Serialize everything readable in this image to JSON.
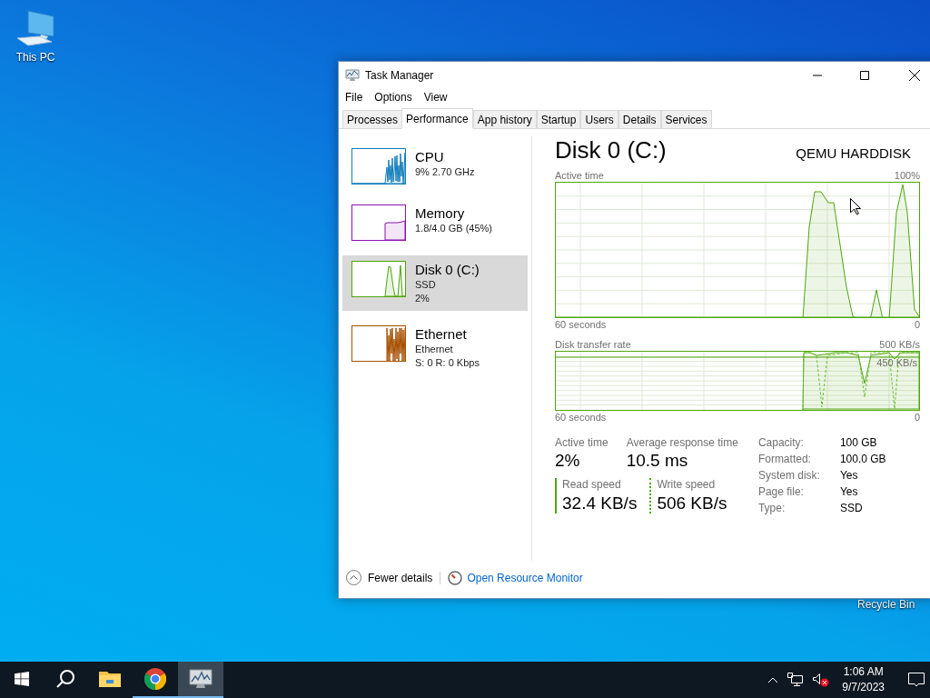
{
  "desktop": {
    "icons": [
      {
        "kind": "computer",
        "label": "This PC"
      },
      {
        "kind": "recycle",
        "label": "Recycle Bin"
      }
    ]
  },
  "window": {
    "title": "Task Manager"
  },
  "menu": [
    "File",
    "Options",
    "View"
  ],
  "tabs": [
    {
      "label": "Processes",
      "selected": false
    },
    {
      "label": "Performance",
      "selected": true
    },
    {
      "label": "App history",
      "selected": false
    },
    {
      "label": "Startup",
      "selected": false
    },
    {
      "label": "Users",
      "selected": false
    },
    {
      "label": "Details",
      "selected": false
    },
    {
      "label": "Services",
      "selected": false
    }
  ],
  "sidebar": {
    "items": [
      {
        "kind": "cpu",
        "name": "CPU",
        "details": [
          "9% 2.70 GHz"
        ],
        "color": "#117dbb",
        "selected": false
      },
      {
        "kind": "memory",
        "name": "Memory",
        "details": [
          "1.8/4.0 GB (45%)"
        ],
        "color": "#8b12ae",
        "selected": false
      },
      {
        "kind": "disk",
        "name": "Disk 0 (C:)",
        "details": [
          "SSD",
          "2%"
        ],
        "color": "#4da60c",
        "selected": true
      },
      {
        "kind": "network",
        "name": "Ethernet",
        "details": [
          "Ethernet",
          "S: 0 R: 0 Kbps"
        ],
        "color": "#a74f01",
        "selected": false
      }
    ]
  },
  "detail": {
    "title": "Disk 0 (C:)",
    "model": "QEMU HARDDISK",
    "charts": [
      {
        "kind": "active",
        "title": "Active time",
        "max_label": "100%",
        "start_label": "60 seconds",
        "end_label": "0"
      },
      {
        "kind": "transfer",
        "title": "Disk transfer rate",
        "max_label": "500 KB/s",
        "scale_label": "450 KB/s",
        "start_label": "60 seconds",
        "end_label": "0"
      }
    ],
    "stats": [
      {
        "label": "Active time",
        "value": "2%"
      },
      {
        "label": "Average response time",
        "value": "10.5 ms"
      }
    ],
    "speeds": [
      {
        "label": "Read speed",
        "value": "32.4 KB/s"
      },
      {
        "label": "Write speed",
        "value": "506 KB/s"
      }
    ],
    "properties": [
      {
        "label": "Capacity:",
        "value": "100 GB"
      },
      {
        "label": "Formatted:",
        "value": "100.0 GB"
      },
      {
        "label": "System disk:",
        "value": "Yes"
      },
      {
        "label": "Page file:",
        "value": "Yes"
      },
      {
        "label": "Type:",
        "value": "SSD"
      }
    ]
  },
  "footer": {
    "fewer_details": "Fewer details",
    "link": "Open Resource Monitor"
  },
  "taskbar": {
    "items": [
      {
        "kind": "start",
        "running": false,
        "selected": false
      },
      {
        "kind": "search",
        "running": false,
        "selected": false
      },
      {
        "kind": "explorer",
        "running": false,
        "selected": false
      },
      {
        "kind": "browser",
        "running": true,
        "selected": false
      },
      {
        "kind": "taskmanager",
        "running": true,
        "selected": true
      }
    ],
    "clock": {
      "time": "1:06 AM",
      "date": "9/7/2023"
    }
  }
}
